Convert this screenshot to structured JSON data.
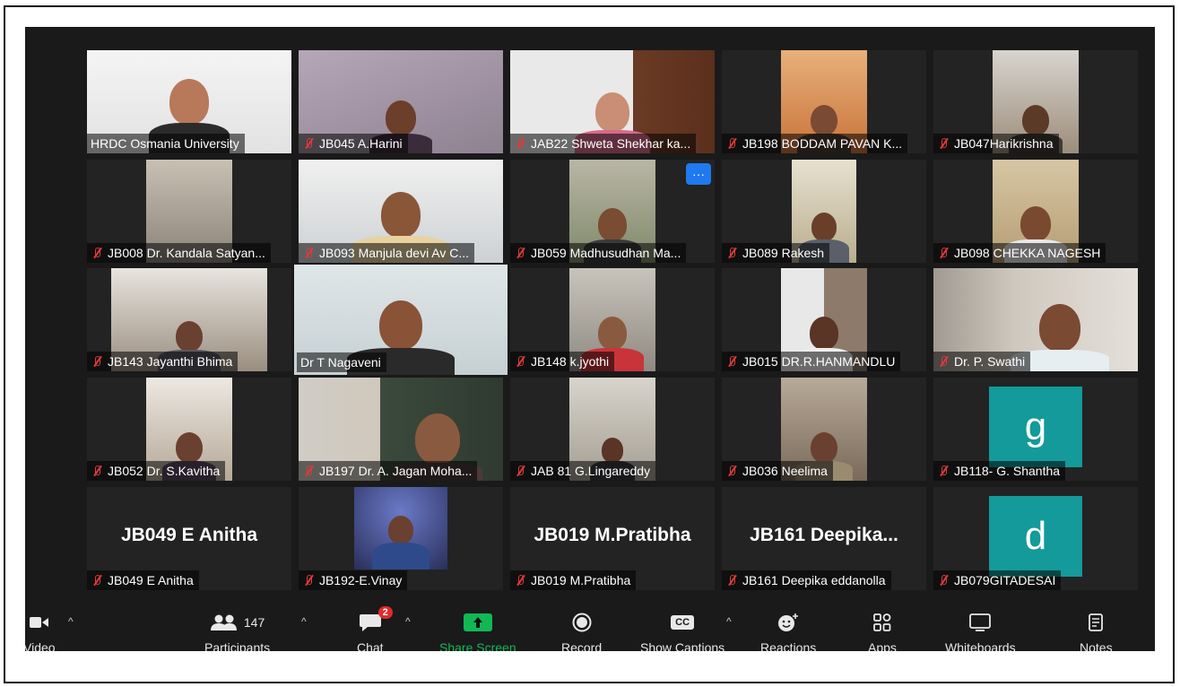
{
  "tiles": [
    {
      "label": "HRDC Osmania University",
      "muted": false
    },
    {
      "label": "JB045 A.Harini",
      "muted": true
    },
    {
      "label": "JAB22 Shweta Shekhar ka...",
      "muted": true
    },
    {
      "label": "JB198 BODDAM PAVAN K...",
      "muted": true
    },
    {
      "label": "JB047Harikrishna",
      "muted": true
    },
    {
      "label": "JB008 Dr. Kandala Satyan...",
      "muted": true
    },
    {
      "label": "JB093 Manjula devi Av C...",
      "muted": true
    },
    {
      "label": "JB059 Madhusudhan Ma...",
      "muted": true
    },
    {
      "label": "JB089 Rakesh",
      "muted": true
    },
    {
      "label": "JB098 CHEKKA NAGESH",
      "muted": true
    },
    {
      "label": "JB143 Jayanthi Bhima",
      "muted": true
    },
    {
      "label": "Dr T Nagaveni",
      "muted": false
    },
    {
      "label": "JB148 k.jyothi",
      "muted": true
    },
    {
      "label": "JB015 DR.R.HANMANDLU",
      "muted": true
    },
    {
      "label": "Dr. P. Swathi",
      "muted": true
    },
    {
      "label": "JB052  Dr. S.Kavitha",
      "muted": true
    },
    {
      "label": "JB197 Dr. A. Jagan Moha...",
      "muted": true
    },
    {
      "label": "JAB 81 G.Lingareddy",
      "muted": true
    },
    {
      "label": "JB036 Neelima",
      "muted": true
    },
    {
      "label": "JB118- G. Shantha",
      "muted": true
    },
    {
      "label": "JB049 E Anitha",
      "muted": true
    },
    {
      "label": "JB192-E.Vinay",
      "muted": true
    },
    {
      "label": "JB019 M.Pratibha",
      "muted": true
    },
    {
      "label": "JB161 Deepika eddanolla",
      "muted": true
    },
    {
      "label": "JB079GITADESAI",
      "muted": true
    }
  ],
  "tile_center_text": {
    "t19": "g",
    "t20": "JB049 E Anitha",
    "t22": "JB019 M.Pratibha",
    "t23": "JB161  Deepika...",
    "t24": "d"
  },
  "more_button": "···",
  "toolbar": {
    "video": "Video",
    "participants": "Participants",
    "participants_count": "147",
    "chat": "Chat",
    "chat_badge": "2",
    "share_screen": "Share Screen",
    "record": "Record",
    "show_captions": "Show Captions",
    "captions_icon_text": "CC",
    "reactions": "Reactions",
    "apps": "Apps",
    "whiteboards": "Whiteboards",
    "notes": "Notes"
  },
  "colors": {
    "background": "#1a1a1a",
    "tile": "#232323",
    "speaker_outline": "#c5e05a",
    "share_green": "#12b855",
    "avatar_teal": "#149a9a",
    "badge_red": "#e02b2b"
  }
}
